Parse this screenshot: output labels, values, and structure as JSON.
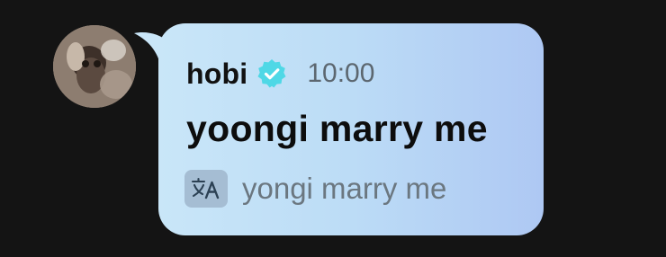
{
  "post": {
    "author_name": "hobi",
    "time": "10:00",
    "message": "yoongi marry me",
    "translation": "yongi marry me"
  },
  "icons": {
    "avatar": "profile-photo",
    "verified": "verified-badge-icon",
    "translate": "translate-icon"
  },
  "colors": {
    "background": "#141414",
    "bubble_left": "#c9e6f8",
    "bubble_right": "#aec8f3",
    "verified_badge": "#4fd8e6"
  }
}
